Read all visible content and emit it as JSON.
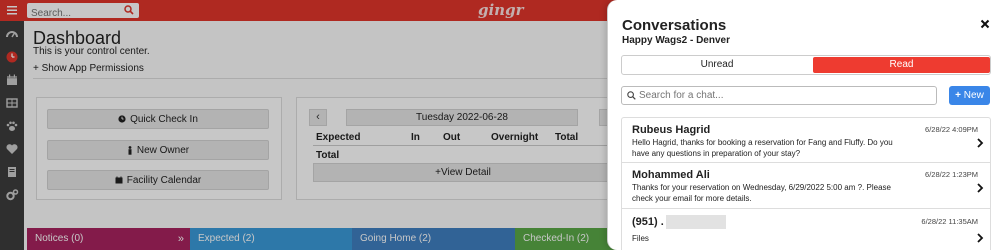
{
  "topbar": {
    "search_placeholder": "Search...",
    "logo": "gingr"
  },
  "sidebar": {
    "icons": [
      "dashboard-gauge-icon",
      "clock-icon",
      "calendar-icon",
      "grid-icon",
      "paw-icon",
      "heart-icon",
      "book-icon",
      "gears-icon"
    ]
  },
  "dashboard": {
    "title": "Dashboard",
    "subtitle": "This is your control center.",
    "permissions_link": "Show App Permissions",
    "quick_buttons": [
      "Quick Check In",
      "New Owner",
      "Facility Calendar"
    ],
    "date_label": "Tuesday 2022-06-28",
    "table_headers": [
      "Expected",
      "In",
      "Out",
      "Overnight",
      "Total"
    ],
    "total_label": "Total",
    "view_detail": "View Detail",
    "tabs": [
      {
        "label": "Notices (0)",
        "color": "#a8235f"
      },
      {
        "label": "Expected (2)",
        "color": "#3a9ad9"
      },
      {
        "label": "Going Home (2)",
        "color": "#3f7fc1"
      },
      {
        "label": "Checked-In (2)",
        "color": "#5aa847"
      }
    ]
  },
  "conversations": {
    "title": "Conversations",
    "location": "Happy Wags2 - Denver",
    "tab_unread": "Unread",
    "tab_read": "Read",
    "search_placeholder": "Search for a chat...",
    "new_button": "New",
    "items": [
      {
        "name": "Rubeus Hagrid",
        "time": "6/28/22 4:09PM",
        "message": "Hello Hagrid, thanks for booking a reservation for Fang and Fluffy. Do you have any questions in preparation of your stay?"
      },
      {
        "name": "Mohammed Ali",
        "time": "6/28/22 1:23PM",
        "message": "Thanks for your reservation on Wednesday, 6/29/2022 5:00 am ?. Please check your email for more details."
      },
      {
        "name": "(951) .",
        "time": "6/28/22 11:35AM",
        "message": "Files"
      }
    ]
  },
  "colors": {
    "brand_red": "#e0352b",
    "read_tab": "#ee3b30",
    "new_button": "#3a86e8"
  }
}
